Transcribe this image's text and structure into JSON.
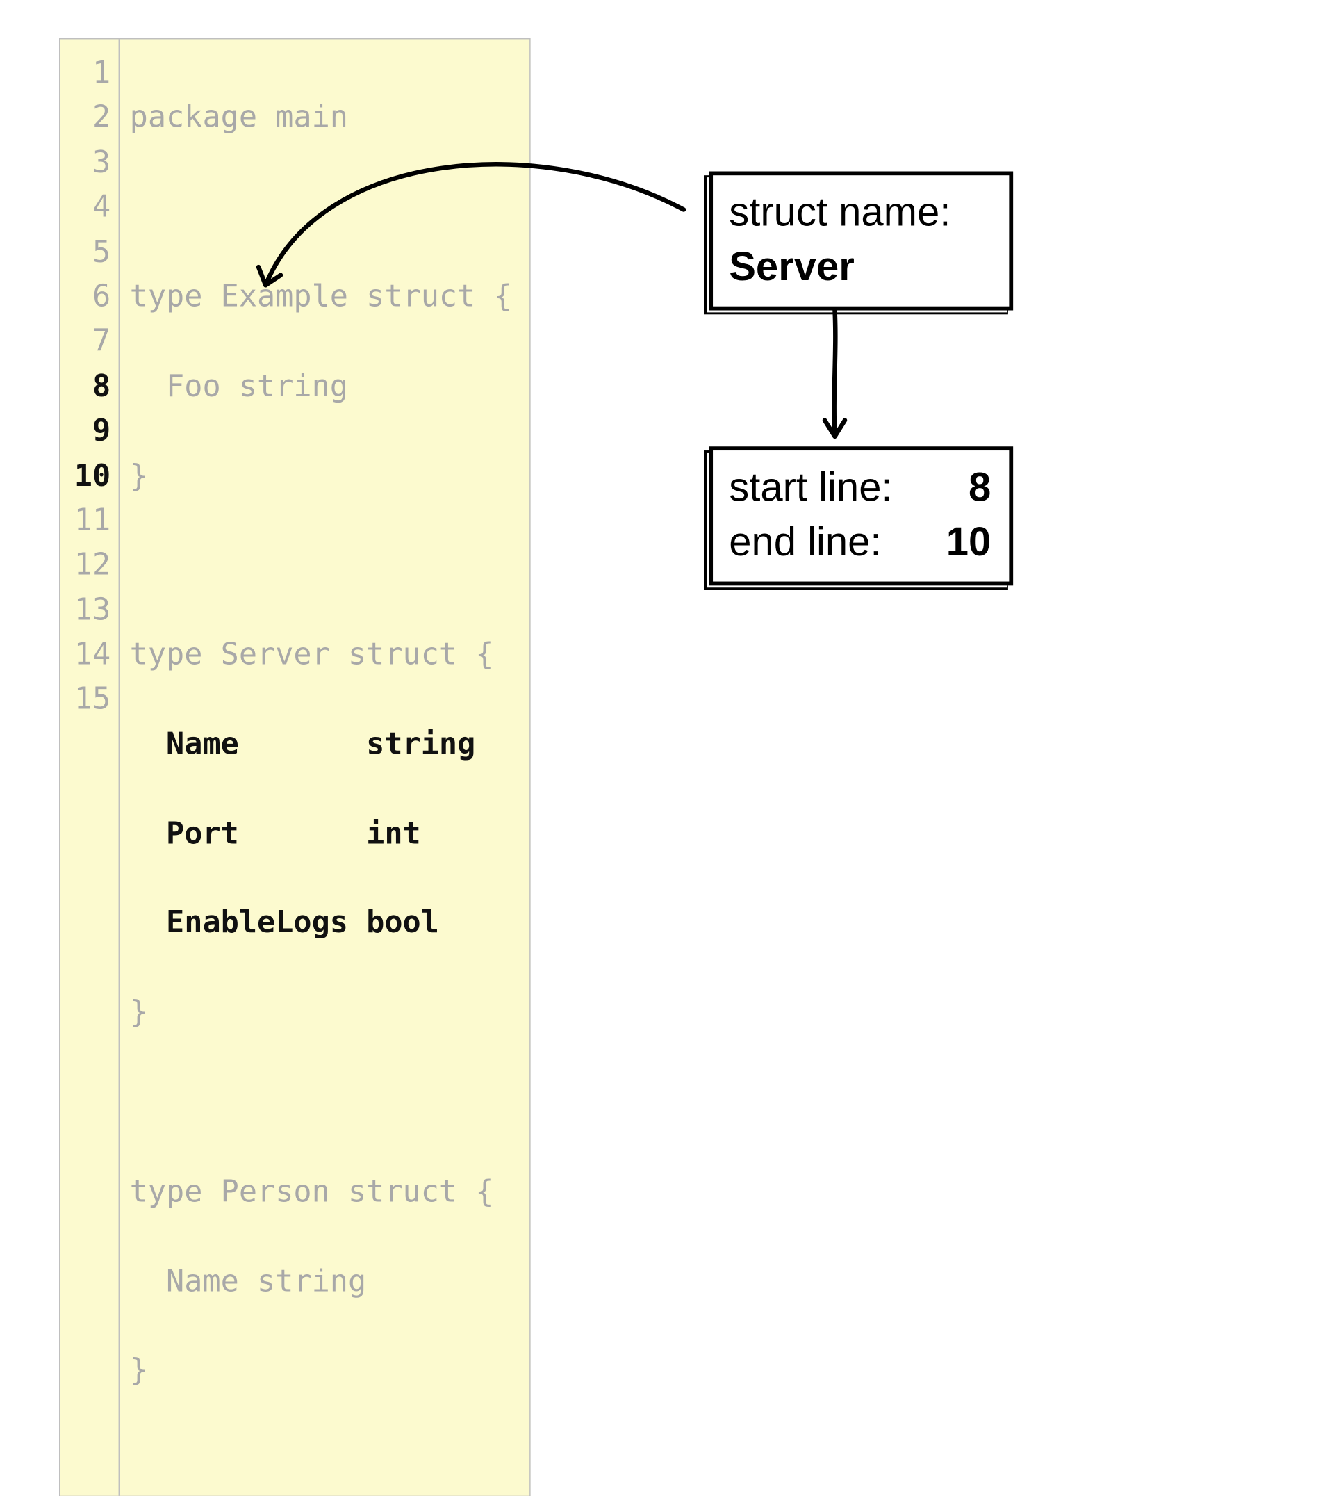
{
  "code": {
    "lines": [
      {
        "n": "1",
        "text": "package main",
        "bold": false
      },
      {
        "n": "2",
        "text": "",
        "bold": false
      },
      {
        "n": "3",
        "text": "type Example struct {",
        "bold": false
      },
      {
        "n": "4",
        "text": "  Foo string",
        "bold": false
      },
      {
        "n": "5",
        "text": "}",
        "bold": false
      },
      {
        "n": "6",
        "text": "",
        "bold": false
      },
      {
        "n": "7",
        "text": "type Server struct {",
        "bold": false
      },
      {
        "n": "8",
        "text": "  Name       string",
        "bold": true
      },
      {
        "n": "9",
        "text": "  Port       int",
        "bold": true
      },
      {
        "n": "10",
        "text": "  EnableLogs bool",
        "bold": true
      },
      {
        "n": "11",
        "text": "}",
        "bold": false
      },
      {
        "n": "12",
        "text": "",
        "bold": false
      },
      {
        "n": "13",
        "text": "type Person struct {",
        "bold": false
      },
      {
        "n": "14",
        "text": "  Name string",
        "bold": false
      },
      {
        "n": "15",
        "text": "}",
        "bold": false
      }
    ]
  },
  "box1": {
    "label": "struct name:",
    "value": "Server"
  },
  "box2": {
    "line1_label": "start line:",
    "line1_value": "8",
    "line2_label": "end line:",
    "line2_value": "10"
  }
}
